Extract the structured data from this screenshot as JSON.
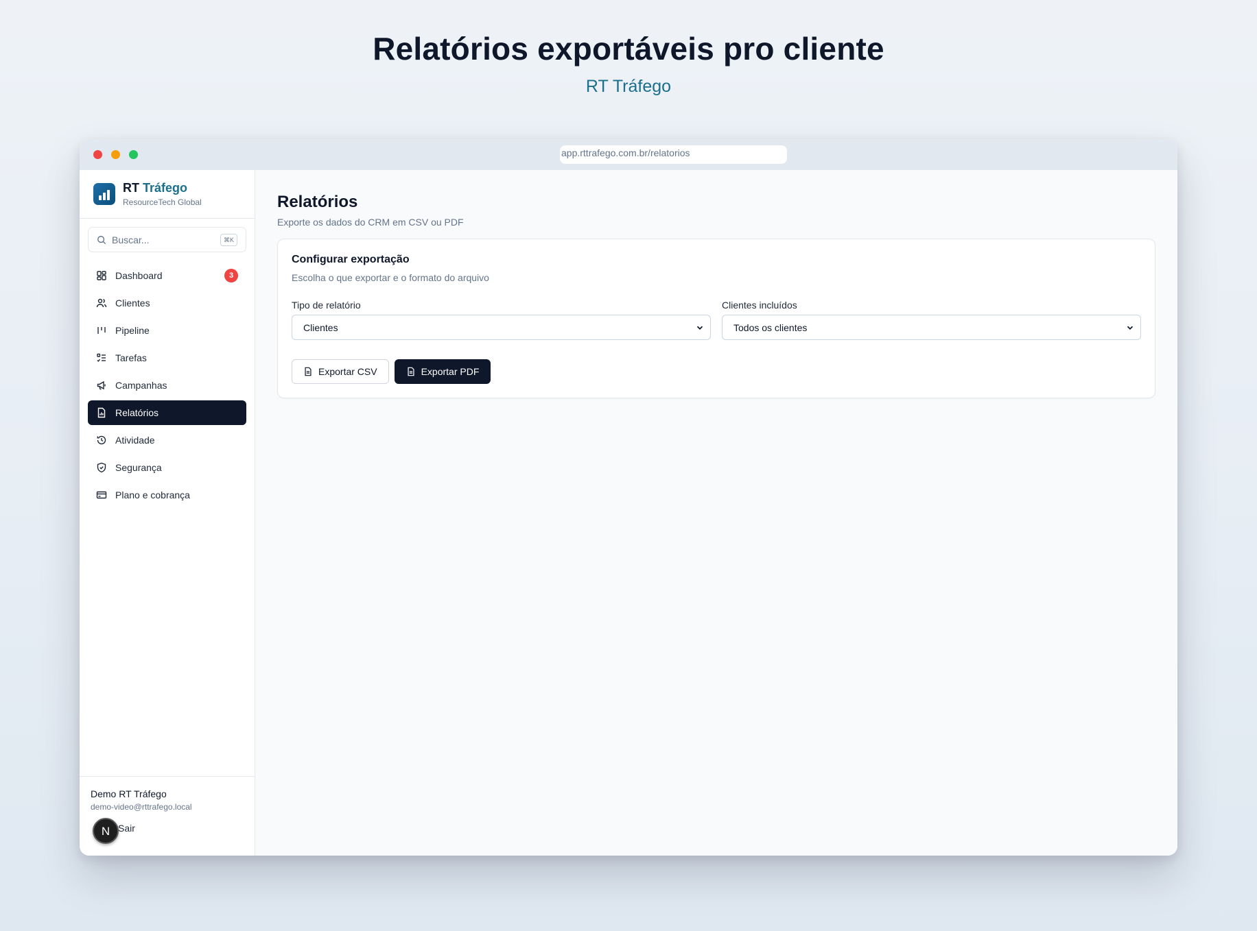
{
  "hero": {
    "title": "Relatórios exportáveis pro cliente",
    "subtitle": "RT Tráfego"
  },
  "browser": {
    "url": "app.rttrafego.com.br/relatorios"
  },
  "sidebar": {
    "brand_name_part1": "RT",
    "brand_name_part2": "Tráfego",
    "brand_tagline": "ResourceTech Global",
    "search_placeholder": "Buscar...",
    "search_shortcut": "⌘K",
    "items": [
      {
        "label": "Dashboard",
        "icon": "dashboard-icon",
        "badge": "3"
      },
      {
        "label": "Clientes",
        "icon": "users-icon"
      },
      {
        "label": "Pipeline",
        "icon": "pipeline-icon"
      },
      {
        "label": "Tarefas",
        "icon": "tasks-icon"
      },
      {
        "label": "Campanhas",
        "icon": "megaphone-icon"
      },
      {
        "label": "Relatórios",
        "icon": "report-icon",
        "active": true
      },
      {
        "label": "Atividade",
        "icon": "history-icon"
      },
      {
        "label": "Segurança",
        "icon": "shield-icon"
      },
      {
        "label": "Plano e cobrança",
        "icon": "credit-card-icon"
      }
    ],
    "user": {
      "name": "Demo RT Tráfego",
      "email": "demo-video@rttrafego.local",
      "logout_label": "Sair",
      "avatar_initial": "N"
    }
  },
  "main": {
    "title": "Relatórios",
    "subtitle": "Exporte os dados do CRM em CSV ou PDF",
    "card": {
      "title": "Configurar exportação",
      "subtitle": "Escolha o que exportar e o formato do arquivo",
      "report_type_label": "Tipo de relatório",
      "report_type_value": "Clientes",
      "clients_label": "Clientes incluídos",
      "clients_value": "Todos os clientes",
      "export_csv_label": "Exportar CSV",
      "export_pdf_label": "Exportar PDF"
    }
  },
  "colors": {
    "accent": "#1a6f8c",
    "active_nav": "#0f172a",
    "badge": "#ef4444"
  }
}
